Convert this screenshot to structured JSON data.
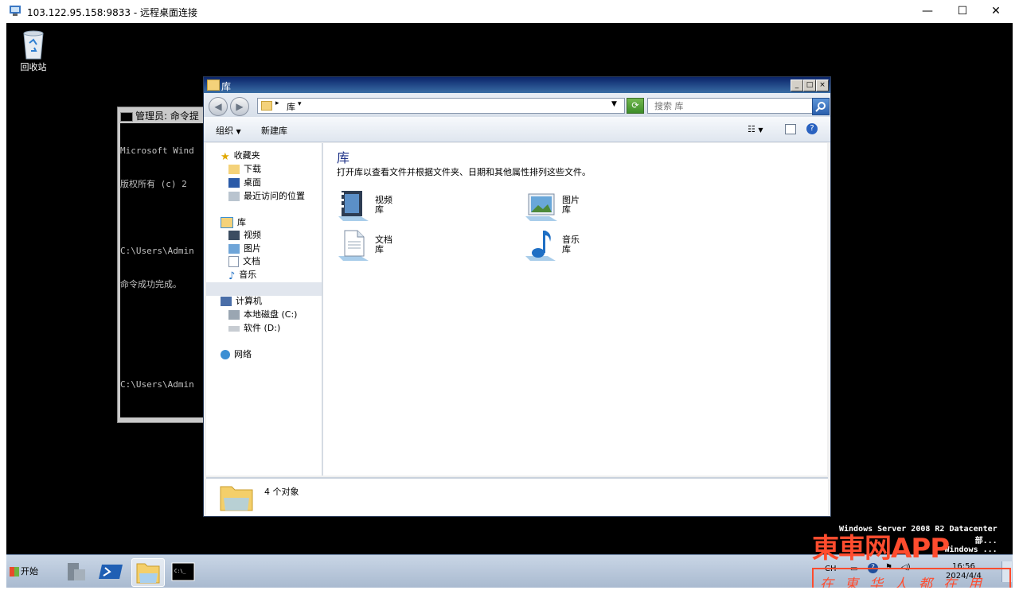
{
  "rdp": {
    "title": "103.122.95.158:9833 - 远程桌面连接",
    "minimize": "—",
    "maximize": "☐",
    "close": "✕"
  },
  "desktop": {
    "recycle_bin_label": "回收站",
    "os_watermark_line1": "Windows Server 2008 R2 Datacenter",
    "os_watermark_line2": "部...",
    "os_watermark_line3": "Windows ...",
    "brand_watermark": "東車网APP",
    "brand_slogan": "在東华人都在用"
  },
  "cmd_window": {
    "title": "管理员: 命令提",
    "lines": [
      "Microsoft Wind",
      "版权所有 (c) 2",
      "",
      "C:\\Users\\Admin",
      "命令成功完成。",
      "",
      "",
      "C:\\Users\\Admin"
    ]
  },
  "explorer": {
    "title": "库",
    "address_path": "库",
    "search_placeholder": "搜索 库",
    "toolbar": {
      "organize": "组织",
      "new_library": "新建库"
    },
    "nav": {
      "favorites": "收藏夹",
      "downloads": "下载",
      "desktop": "桌面",
      "recent": "最近访问的位置",
      "libraries": "库",
      "videos": "视频",
      "pictures": "图片",
      "documents": "文档",
      "music": "音乐",
      "computer": "计算机",
      "local_disk": "本地磁盘 (C:)",
      "software_disk": "软件 (D:)",
      "network": "网络"
    },
    "content": {
      "heading": "库",
      "description": "打开库以查看文件并根据文件夹、日期和其他属性排列这些文件。",
      "items": [
        {
          "name": "视频",
          "sub": "库"
        },
        {
          "name": "图片",
          "sub": "库"
        },
        {
          "name": "文档",
          "sub": "库"
        },
        {
          "name": "音乐",
          "sub": "库"
        }
      ]
    },
    "details": {
      "count_text": "4 个对象"
    }
  },
  "taskbar": {
    "start_label": "开始",
    "lang": "CH",
    "time": "16:56",
    "date": "2024/4/4"
  },
  "colors": {
    "title_gradient_start": "#0a246a",
    "title_gradient_end": "#3a6ea5",
    "heading_blue": "#1e3287",
    "watermark_red": "#ff4c2e"
  }
}
